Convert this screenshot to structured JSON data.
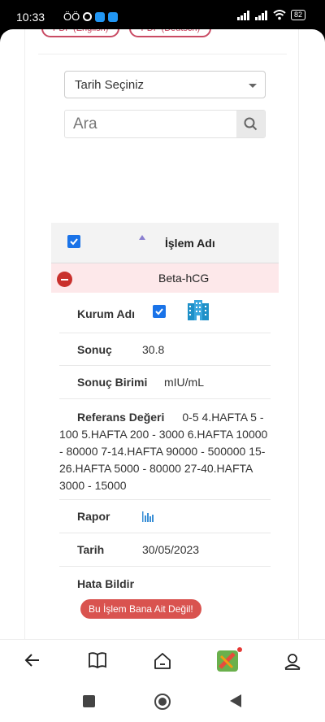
{
  "status_bar": {
    "time": "10:33",
    "carrier_marks": "ÖÖ",
    "battery": "82"
  },
  "top_buttons": {
    "pdf_english": "PDF (English)",
    "pdf_deutsch": "PDF (Deutsch)"
  },
  "date_select": {
    "selected": "Tarih Seçiniz"
  },
  "search": {
    "placeholder": "Ara"
  },
  "table": {
    "header_label": "İşlem Adı",
    "row_name": "Beta-hCG",
    "details": {
      "kurum_label": "Kurum Adı",
      "sonuc_label": "Sonuç",
      "sonuc_value": "30.8",
      "birim_label": "Sonuç Birimi",
      "birim_value": "mIU/mL",
      "referans_label": "Referans Değeri",
      "referans_value": "0-5 4.HAFTA 5 - 100 5.HAFTA 200 - 3000 6.HAFTA 10000 - 80000 7-14.HAFTA 90000 - 500000 15-26.HAFTA 5000 - 80000 27-40.HAFTA 3000 - 15000",
      "rapor_label": "Rapor",
      "tarih_label": "Tarih",
      "tarih_value": "30/05/2023",
      "hata_label": "Hata Bildir",
      "hata_button": "Bu İşlem Bana Ait Değil!"
    }
  },
  "icons": {
    "building": "building-icon",
    "report": "bar-chart-icon",
    "back": "arrow-left-icon",
    "book": "book-icon",
    "home": "home-icon",
    "app": "app-icon",
    "profile": "profile-icon"
  },
  "colors": {
    "accent_pink": "#c94a63",
    "row_highlight": "#fde8ea",
    "danger": "#d9534f",
    "checkbox_blue": "#1a73e8"
  }
}
